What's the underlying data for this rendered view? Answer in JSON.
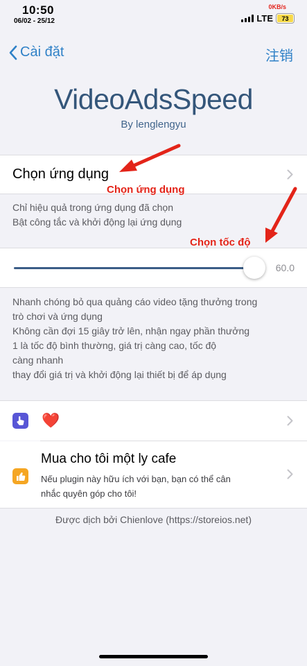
{
  "status_bar": {
    "time": "10:50",
    "date": "06/02 - 25/12",
    "net_speed": "0KB/s",
    "carrier": "LTE",
    "battery": "73"
  },
  "nav": {
    "back_label": "Cài đặt",
    "right_label": "注销"
  },
  "header": {
    "title": "VideoAdsSpeed",
    "author": "By lenglengyu"
  },
  "app_picker": {
    "label": "Chọn ứng dụng",
    "footer_line1": "Chỉ hiệu quả trong ứng dụng đã chọn",
    "footer_line2": "Bật công tắc và khởi động lại ứng dụng"
  },
  "speed_slider": {
    "value": "60.0",
    "fraction": 0.9,
    "footer_lines": [
      "Nhanh chóng bỏ qua quảng cáo video tặng thưởng trong",
      "trò chơi và ứng dụng",
      "Không cần đợi 15 giây trở lên, nhận ngay phần thưởng",
      "1 là tốc độ bình thường, giá trị càng cao, tốc độ",
      "càng nhanh",
      "thay đổi giá trị và khởi động lại thiết bị để áp dụng"
    ]
  },
  "links": {
    "heart_emoji": "❤️",
    "coffee_title": "Mua cho tôi một ly cafe",
    "coffee_sub_line1": "Nếu plugin này hữu ích với bạn, bạn có thể cân",
    "coffee_sub_line2": "nhắc quyên góp cho tôi!"
  },
  "credit": "Được dịch bởi Chienlove (https://storeios.net)",
  "annotations": {
    "app_hint": "Chọn ứng dụng",
    "speed_hint": "Chọn tốc độ"
  },
  "colors": {
    "accent": "#2f81c7",
    "title": "#34567a",
    "annotation": "#e32419",
    "icon_purple": "#5856d6",
    "icon_orange": "#f5a623"
  },
  "icons": {
    "back": "chevron-left-icon",
    "row_chevron": "chevron-right-icon",
    "tap": "hand-tap-icon",
    "thumbs_up": "thumbs-up-icon"
  }
}
